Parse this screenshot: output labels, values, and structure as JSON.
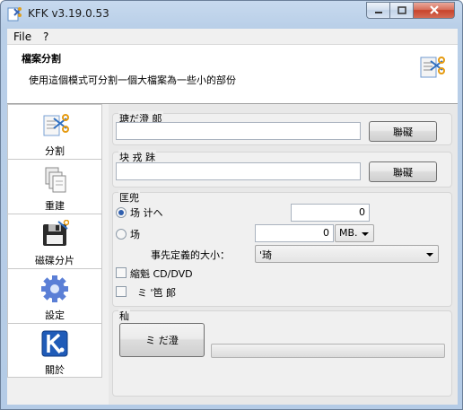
{
  "window": {
    "title": "KFK v3.19.0.53"
  },
  "menu": {
    "file": "File",
    "help": "?"
  },
  "header": {
    "title": "檔案分割",
    "description": "使用這個模式可分割一個大檔案為一些小的部份"
  },
  "sidebar": {
    "items": [
      {
        "label": "分割",
        "icon": "scissors-file-icon"
      },
      {
        "label": "重建",
        "icon": "files-stack-icon"
      },
      {
        "label": "磁碟分片",
        "icon": "floppy-disk-icon"
      },
      {
        "label": "設定",
        "icon": "gear-icon"
      },
      {
        "label": "關於",
        "icon": "kfk-logo-icon"
      }
    ]
  },
  "source_group": {
    "title": "瑭だ澄  郞",
    "path_value": "",
    "browse_label": "聯礙"
  },
  "dest_group": {
    "title": "块  戎  跊",
    "path_value": "",
    "browse_label": "聯礙"
  },
  "options_group": {
    "title": "匡兜",
    "radio_parts": {
      "label": "场        计ヘ",
      "checked": true,
      "value": "0"
    },
    "radio_size": {
      "label": "场",
      "checked": false,
      "value": "0",
      "unit": "MB."
    },
    "preset_label": "事先定義的大小：",
    "preset_value": "'琦",
    "cd_checkbox": {
      "label": "縮魁      CD/DVD",
      "checked": false
    },
    "misc_checkbox": {
      "label": "ミ  '笆          郞",
      "checked": false
    }
  },
  "action_group": {
    "title": "秈",
    "start_label": "ミ    だ澄"
  },
  "progress": {
    "value": 0
  },
  "colors": {
    "titlebar": "#b9cfe8",
    "close_button": "#c8432b",
    "progress_fill": "#37c245"
  }
}
